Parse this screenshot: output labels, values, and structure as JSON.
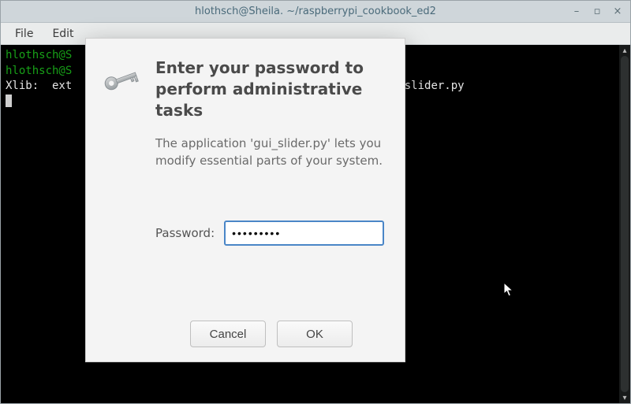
{
  "titlebar": {
    "title": "hlothsch@Sheila. ~/raspberrypi_cookbook_ed2"
  },
  "menubar": {
    "file": "File",
    "edit": "Edit"
  },
  "terminal": {
    "line1_prompt": "hlothsch@S",
    "line2_prompt": "hlothsch@S",
    "line3_pre": "Xlib:  ext",
    "line3_post": "                                              gui_slider.py"
  },
  "dialog": {
    "heading": "Enter your password to perform administrative tasks",
    "description": "The application 'gui_slider.py' lets you modify essential parts of your system.",
    "password_label": "Password:",
    "password_value": "•••••••••",
    "cancel_label": "Cancel",
    "ok_label": "OK"
  }
}
